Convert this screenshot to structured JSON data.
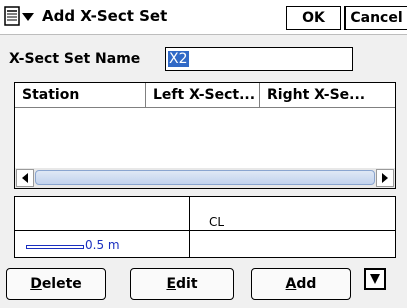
{
  "window": {
    "title": "Add X-Sect Set"
  },
  "titlebar": {
    "ok_label": "OK",
    "cancel_label": "Cancel"
  },
  "form": {
    "name_label": "X-Sect Set Name",
    "name_value": "X2"
  },
  "listview": {
    "columns": [
      "Station",
      "Left X-Sect...",
      "Right X-Se..."
    ],
    "rows": []
  },
  "xsect": {
    "centerline_label": "CL",
    "scale_label": "0.5 m"
  },
  "buttons": {
    "delete": {
      "mnemonic": "D",
      "rest": "elete"
    },
    "edit": {
      "mnemonic": "E",
      "rest": "dit"
    },
    "add": {
      "mnemonic": "A",
      "rest": "dd"
    }
  },
  "colors": {
    "selection": "#3169c6",
    "scale": "#1a2fbf"
  }
}
